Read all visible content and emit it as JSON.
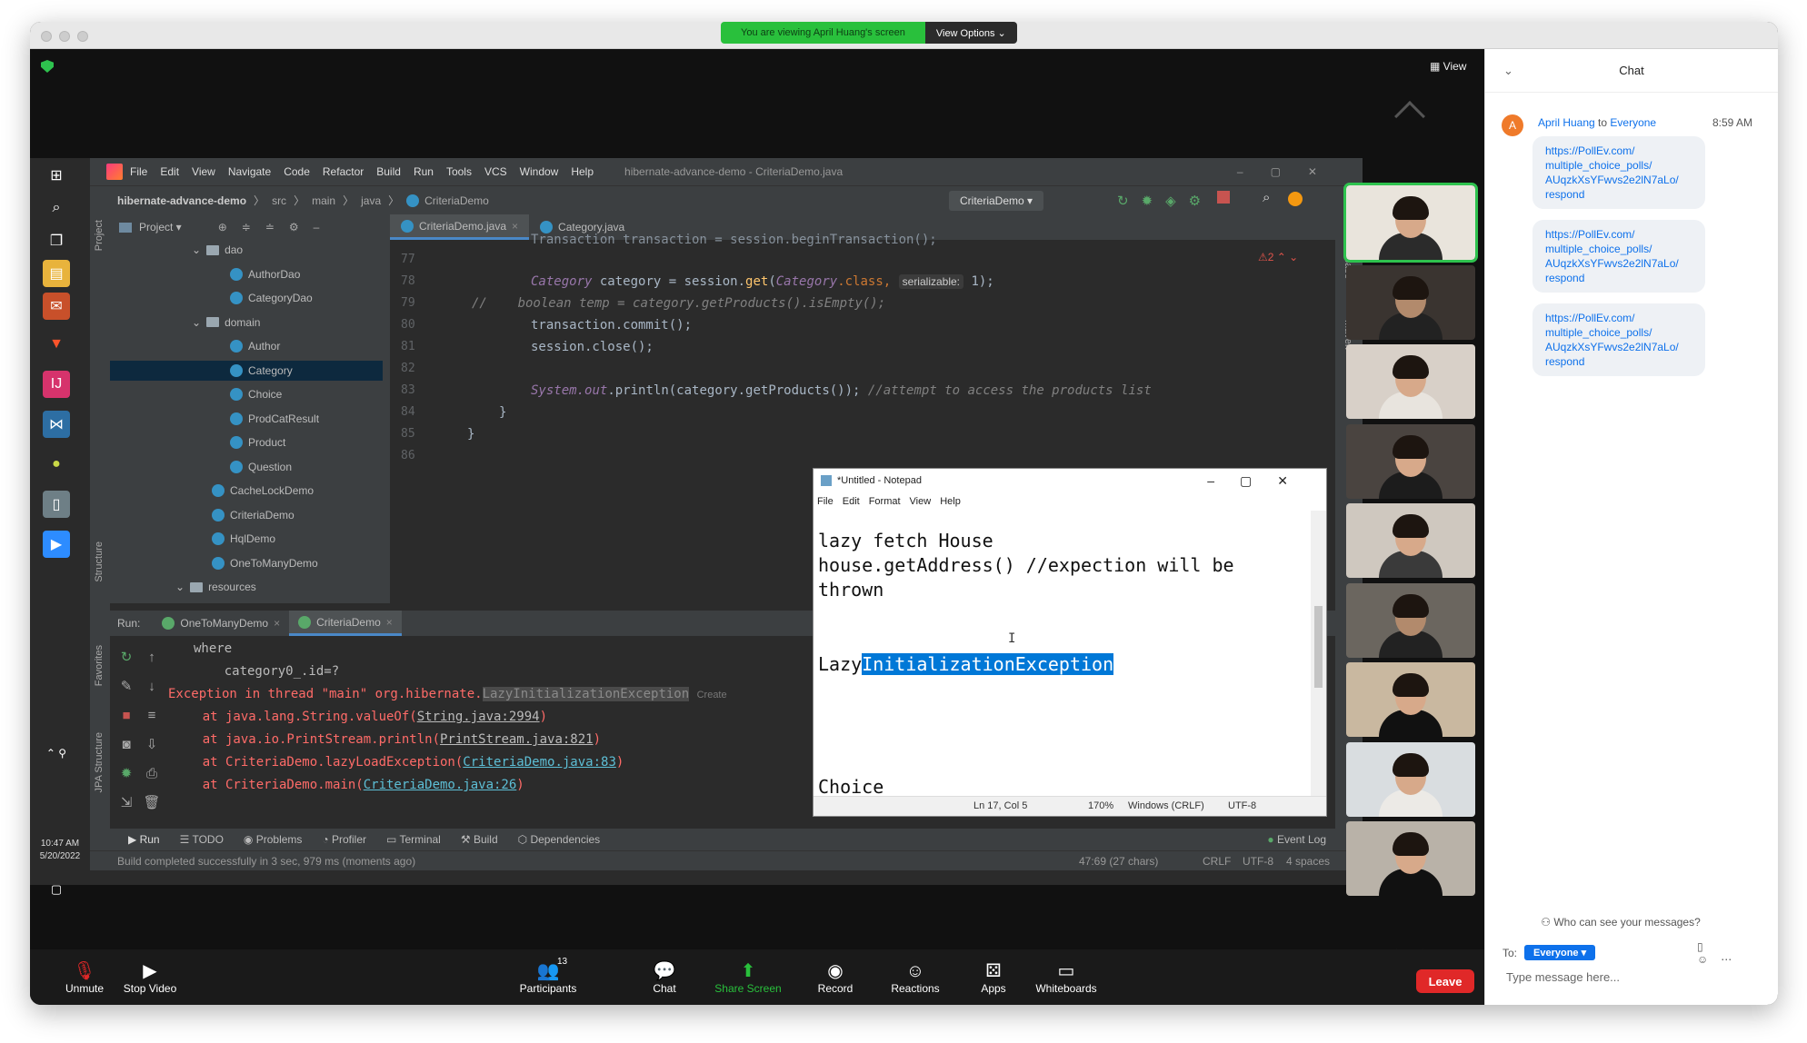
{
  "zoom": {
    "banner_text": "You are viewing April Huang's screen",
    "view_options": "View Options ⌄",
    "view_button": "View",
    "controls": [
      {
        "label": "Unmute",
        "icon": "mic-muted-icon"
      },
      {
        "label": "Stop Video",
        "icon": "camera-icon"
      },
      {
        "label": "Participants",
        "icon": "participants-icon",
        "count": "13"
      },
      {
        "label": "Chat",
        "icon": "chat-icon"
      },
      {
        "label": "Share Screen",
        "icon": "share-screen-icon"
      },
      {
        "label": "Record",
        "icon": "record-icon"
      },
      {
        "label": "Reactions",
        "icon": "reactions-icon"
      },
      {
        "label": "Apps",
        "icon": "apps-icon"
      },
      {
        "label": "Whiteboards",
        "icon": "whiteboard-icon"
      }
    ],
    "leave": "Leave",
    "accent": "#0e71eb",
    "share_green": "#29c03c"
  },
  "chat": {
    "title": "Chat",
    "sender": "April Huang",
    "to_word": "to",
    "recipient": "Everyone",
    "time": "8:59 AM",
    "avatar_letter": "A",
    "messages": [
      "https://PollEv.com/\nmultiple_choice_polls/\nAUqzkXsYFwvs2e2lN7aLo/\nrespond",
      "https://PollEv.com/\nmultiple_choice_polls/\nAUqzkXsYFwvs2e2lN7aLo/\nrespond",
      "https://PollEv.com/\nmultiple_choice_polls/\nAUqzkXsYFwvs2e2lN7aLo/\nrespond"
    ],
    "who_can_see": "Who can see your messages?",
    "to_label": "To:",
    "to_value": "Everyone ▾",
    "placeholder": "Type message here..."
  },
  "windows_clock": {
    "time": "10:47 AM",
    "date": "5/20/2022"
  },
  "ide": {
    "menus": [
      "File",
      "Edit",
      "View",
      "Navigate",
      "Code",
      "Refactor",
      "Build",
      "Run",
      "Tools",
      "VCS",
      "Window",
      "Help"
    ],
    "window_title": "hibernate-advance-demo - CriteriaDemo.java",
    "breadcrumbs": [
      "hibernate-advance-demo",
      "src",
      "main",
      "java",
      "CriteriaDemo"
    ],
    "run_config": "CriteriaDemo ▾",
    "project_label": "Project ▾",
    "left_strip": [
      "Project",
      "Structure",
      "Favorites",
      "JPA Structure"
    ],
    "right_strip": [
      "Database",
      "Maven"
    ],
    "tree": [
      {
        "label": "dao",
        "type": "folder",
        "indent": 1
      },
      {
        "label": "AuthorDao",
        "type": "class",
        "indent": 2
      },
      {
        "label": "CategoryDao",
        "type": "class",
        "indent": 2
      },
      {
        "label": "domain",
        "type": "folder",
        "indent": 1
      },
      {
        "label": "Author",
        "type": "class",
        "indent": 2
      },
      {
        "label": "Category",
        "type": "class",
        "indent": 2,
        "selected": true
      },
      {
        "label": "Choice",
        "type": "class",
        "indent": 2
      },
      {
        "label": "ProdCatResult",
        "type": "class",
        "indent": 2
      },
      {
        "label": "Product",
        "type": "class",
        "indent": 2
      },
      {
        "label": "Question",
        "type": "class",
        "indent": 2
      },
      {
        "label": "CacheLockDemo",
        "type": "class",
        "indent": 1
      },
      {
        "label": "CriteriaDemo",
        "type": "class",
        "indent": 1
      },
      {
        "label": "HqlDemo",
        "type": "class",
        "indent": 1
      },
      {
        "label": "OneToManyDemo",
        "type": "class",
        "indent": 1
      },
      {
        "label": "resources",
        "type": "folder",
        "indent": 0
      }
    ],
    "tabs": [
      "CriteriaDemo.java",
      "Category.java"
    ],
    "warning_count": "2",
    "line_numbers": [
      "77",
      "78",
      "79",
      "80",
      "81",
      "82",
      "83",
      "84",
      "85",
      "86"
    ],
    "code": {
      "l76": "Transaction transaction = session.beginTransaction();",
      "l78a": "Category",
      "l78b": " category = session.",
      "l78c": "get",
      "l78d": "(",
      "l78e": "Category",
      "l78f": ".class,",
      "l78hint": "serializable:",
      "l78g": " 1);",
      "l79a": "//",
      "l79b": "boolean temp = category.getProducts().isEmpty();",
      "l80": "transaction.commit();",
      "l81": "session.close();",
      "l83a": "System.",
      "l83b": "out",
      "l83c": ".println(category.getProducts()); ",
      "l83d": "//attempt to access the products list",
      "l84": "}",
      "l85": "}"
    },
    "run_label": "Run:",
    "run_tabs": [
      "OneToManyDemo",
      "CriteriaDemo"
    ],
    "console": {
      "c1": "where",
      "c2": "    category0_.id=?",
      "c3a": "Exception in thread \"main\" org.hibernate.",
      "c3b": "LazyInitializationException",
      "c3c": "Create",
      "c4a": "    at java.lang.String.valueOf(",
      "c4b": "String.java:2994",
      "c4c": ")",
      "c5a": "    at java.io.PrintStream.println(",
      "c5b": "PrintStream.java:821",
      "c5c": ")",
      "c6a": "    at CriteriaDemo.lazyLoadException(",
      "c6b": "CriteriaDemo.java:83",
      "c6c": ")",
      "c7a": "    at CriteriaDemo.main(",
      "c7b": "CriteriaDemo.java:26",
      "c7c": ")"
    },
    "bottom_tabs": [
      "Run",
      "TODO",
      "Problems",
      "Profiler",
      "Terminal",
      "Build",
      "Dependencies"
    ],
    "event_log": "Event Log",
    "status_msg": "Build completed successfully in 3 sec, 979 ms (moments ago)",
    "status_right": [
      "47:69 (27 chars)",
      "CRLF",
      "UTF-8",
      "4 spaces"
    ]
  },
  "notepad": {
    "title": "*Untitled - Notepad",
    "menus": [
      "File",
      "Edit",
      "Format",
      "View",
      "Help"
    ],
    "line1": "lazy fetch House",
    "line2": "house.getAddress() //expection will be",
    "line3": "thrown",
    "line5a": "Lazy",
    "line5b": "InitializationException",
    "line6": "Choice",
    "status": [
      "Ln 17, Col 5",
      "170%",
      "Windows (CRLF)",
      "UTF-8"
    ]
  }
}
